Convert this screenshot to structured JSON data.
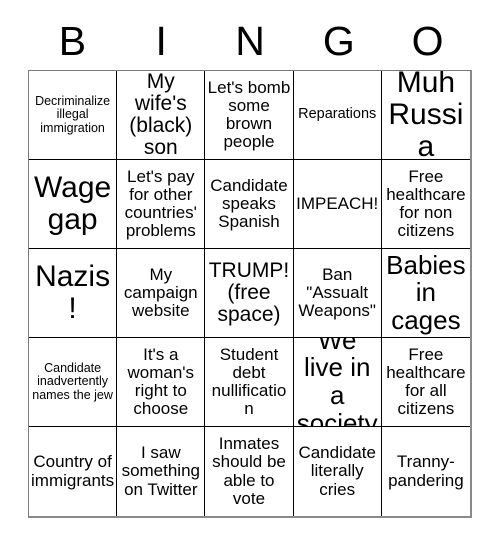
{
  "card": {
    "header_letters": [
      "B",
      "I",
      "N",
      "G",
      "O"
    ],
    "rows": [
      [
        {
          "text": "Decriminalize illegal immigration",
          "size": "fs-xs"
        },
        {
          "text": "My wife's (black) son",
          "size": "fs-lg"
        },
        {
          "text": "Let's bomb some brown people",
          "size": "fs-md"
        },
        {
          "text": "Reparations",
          "size": "fs-sm"
        },
        {
          "text": "Muh Russia",
          "size": "fs-xxl"
        }
      ],
      [
        {
          "text": "Wage gap",
          "size": "fs-xxl"
        },
        {
          "text": "Let's pay for other countries' problems",
          "size": "fs-md"
        },
        {
          "text": "Candidate speaks Spanish",
          "size": "fs-md"
        },
        {
          "text": "IMPEACH!",
          "size": "fs-md"
        },
        {
          "text": "Free healthcare for non citizens",
          "size": "fs-md"
        }
      ],
      [
        {
          "text": "Nazis!",
          "size": "fs-xxl"
        },
        {
          "text": "My campaign website",
          "size": "fs-md"
        },
        {
          "text": "TRUMP! (free space)",
          "size": "fs-lg"
        },
        {
          "text": "Ban \"Assualt Weapons\"",
          "size": "fs-md"
        },
        {
          "text": "Babies in cages",
          "size": "fs-xl"
        }
      ],
      [
        {
          "text": "Candidate inadvertently names the jew",
          "size": "fs-xs"
        },
        {
          "text": "It's a woman's right to choose",
          "size": "fs-md"
        },
        {
          "text": "Student debt nullification",
          "size": "fs-md"
        },
        {
          "text": "We live in a society",
          "size": "fs-xl"
        },
        {
          "text": "Free healthcare for all citizens",
          "size": "fs-md"
        }
      ],
      [
        {
          "text": "Country of immigrants",
          "size": "fs-md"
        },
        {
          "text": "I saw something on Twitter",
          "size": "fs-md"
        },
        {
          "text": "Inmates should be able to vote",
          "size": "fs-md"
        },
        {
          "text": "Candidate literally cries",
          "size": "fs-md"
        },
        {
          "text": "Tranny-pandering",
          "size": "fs-md"
        }
      ]
    ]
  }
}
